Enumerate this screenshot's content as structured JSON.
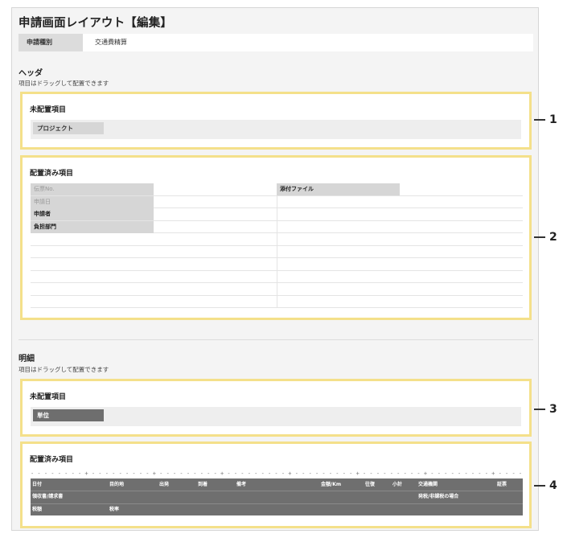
{
  "title": "申請画面レイアウト【編集】",
  "application_type": {
    "label": "申請種別",
    "value": "交通費精算"
  },
  "header_section": {
    "heading": "ヘッダ",
    "description": "項目はドラッグして配置できます"
  },
  "detail_section": {
    "heading": "明細",
    "description": "項目はドラッグして配置できます"
  },
  "boxes": {
    "unplaced_title": "未配置項目",
    "placed_title": "配置済み項目"
  },
  "header_unplaced_items": [
    "プロジェクト"
  ],
  "header_placed_items": {
    "left": [
      {
        "label": "伝票No.",
        "dim": true
      },
      {
        "label": "申請日",
        "dim": true
      },
      {
        "label": "申請者",
        "dim": false
      },
      {
        "label": "負担部門",
        "dim": false
      }
    ],
    "right": [
      {
        "label": "添付ファイル",
        "dim": false
      }
    ]
  },
  "detail_unplaced_items": [
    "単位"
  ],
  "detail_ruler": "- - - - - - - - + - - - - - - - - - + - - - - - - - - - + - - - - - - - - - + - - - - - - - - - + - - - - - - - - - + - - - - - - - - - + - - - - - - - - - + - - - - - - - - - +",
  "detail_rows": [
    [
      "日付",
      "目的地",
      "出発",
      "到着",
      "備考",
      "金額/Km",
      "往復",
      "小計",
      "交通機関",
      "証票"
    ],
    [
      "領収書/請求書",
      "発税/非課税の場合"
    ],
    [
      "税額",
      "税率"
    ]
  ],
  "markers": [
    "1",
    "2",
    "3",
    "4"
  ],
  "colors": {
    "highlight_border": "#f4e08a",
    "detail_table_bg": "#6f6f6f",
    "chip_light": "#d6d6d6",
    "chip_dark": "#6e6e6e"
  }
}
